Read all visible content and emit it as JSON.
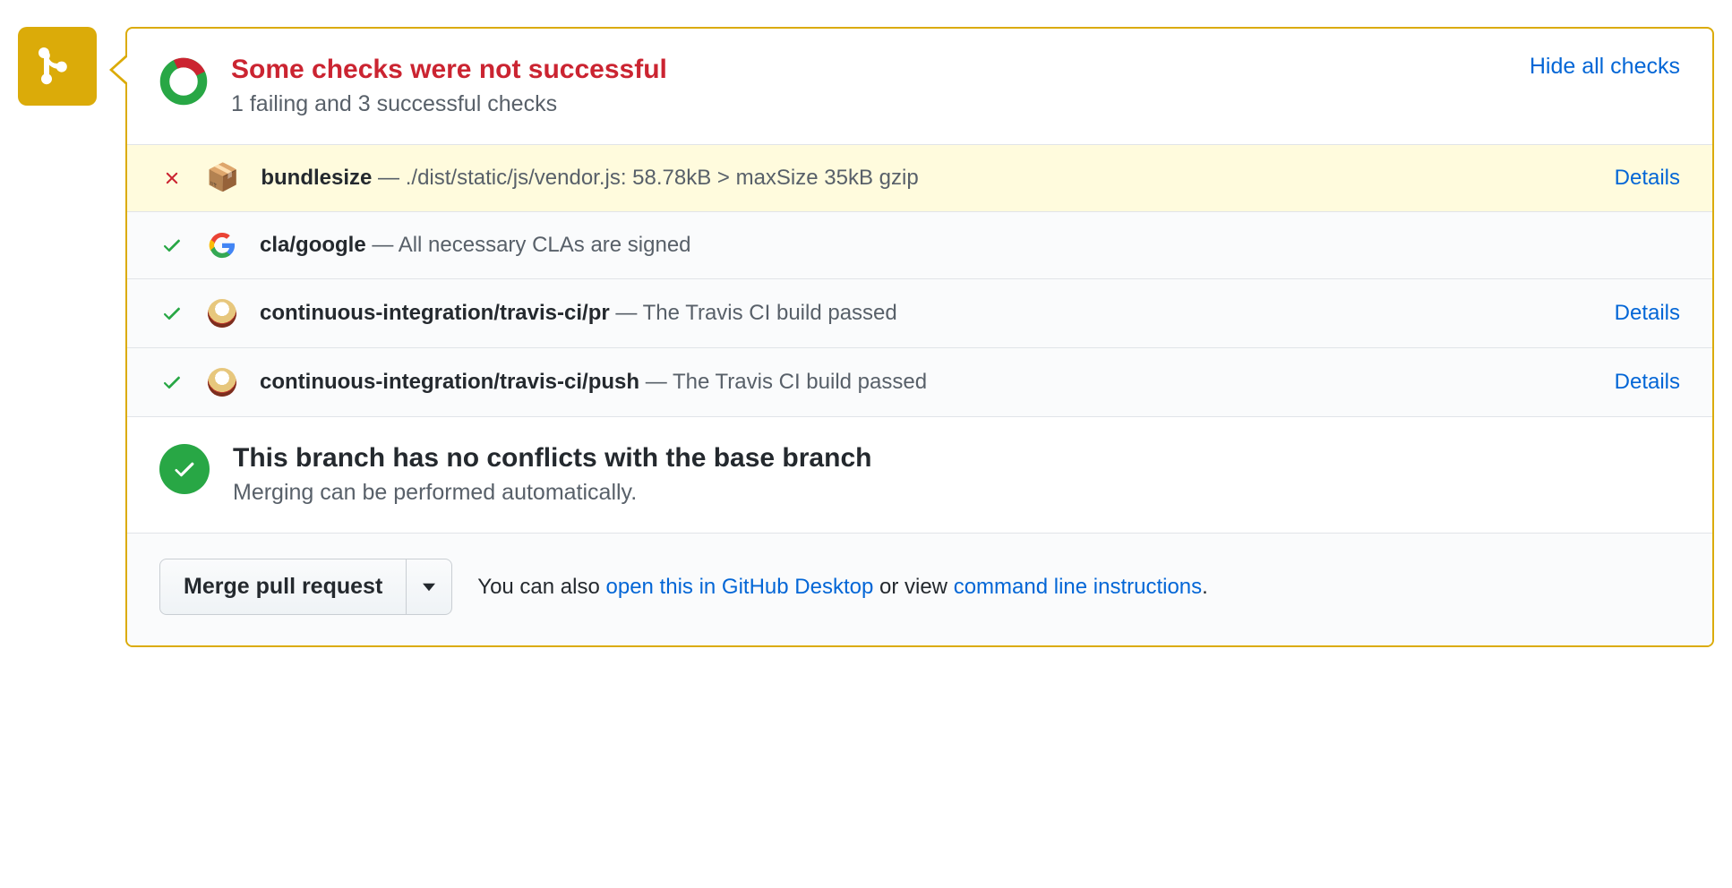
{
  "header": {
    "title": "Some checks were not successful",
    "subtitle": "1 failing and 3 successful checks",
    "toggle": "Hide all checks"
  },
  "checks": [
    {
      "status": "fail",
      "logo": "package",
      "name": "bundlesize",
      "desc": "./dist/static/js/vendor.js: 58.78kB > maxSize 35kB gzip",
      "details": "Details"
    },
    {
      "status": "pass",
      "logo": "google",
      "name": "cla/google",
      "desc": "All necessary CLAs are signed",
      "details": ""
    },
    {
      "status": "pass",
      "logo": "travis",
      "name": "continuous-integration/travis-ci/pr",
      "desc": "The Travis CI build passed",
      "details": "Details"
    },
    {
      "status": "pass",
      "logo": "travis",
      "name": "continuous-integration/travis-ci/push",
      "desc": "The Travis CI build passed",
      "details": "Details"
    }
  ],
  "merge": {
    "title": "This branch has no conflicts with the base branch",
    "subtitle": "Merging can be performed automatically."
  },
  "footer": {
    "merge_button": "Merge pull request",
    "text_before": "You can also ",
    "link_desktop": "open this in GitHub Desktop",
    "text_middle": " or view ",
    "link_cli": "command line instructions",
    "text_after": "."
  }
}
